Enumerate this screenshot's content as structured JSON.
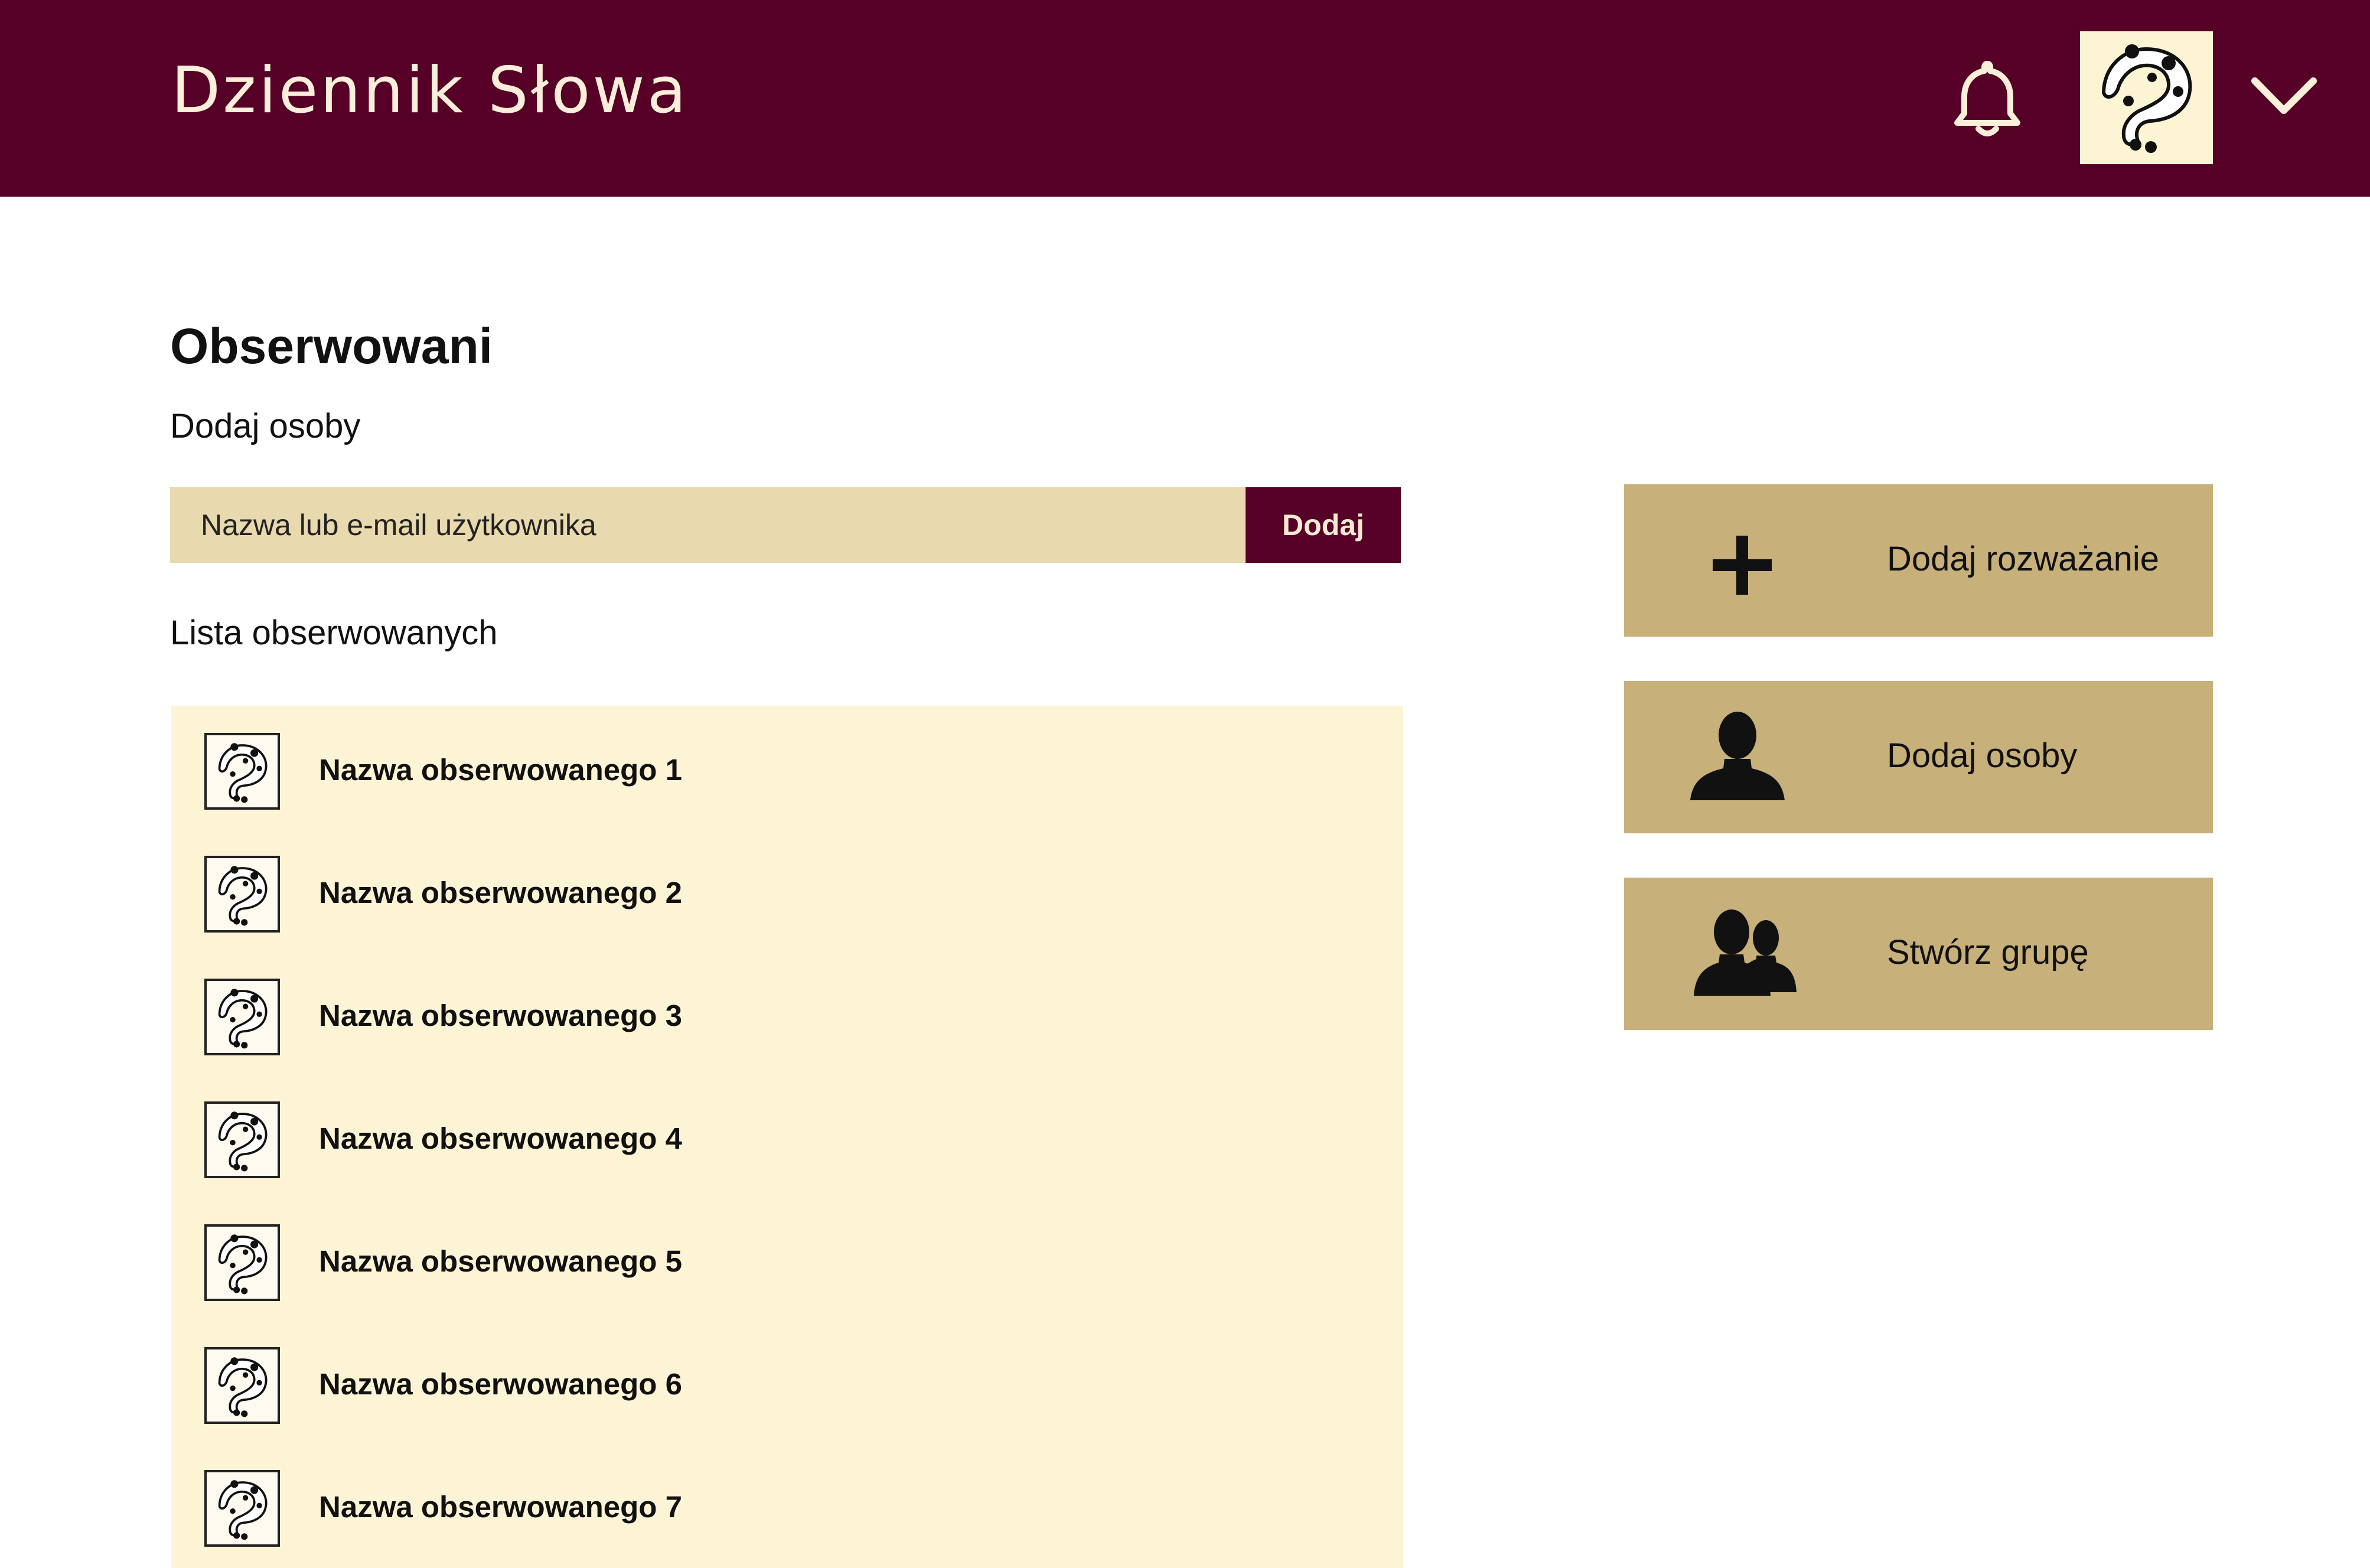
{
  "header": {
    "app_title": "Dziennik Słowa",
    "icons": [
      "bell-icon",
      "user-avatar",
      "chevron-down-icon"
    ],
    "background": "#560027"
  },
  "main": {
    "page_title": "Obserwowani",
    "add_people_label": "Dodaj osoby",
    "search": {
      "placeholder": "Nazwa lub e-mail użytkownika",
      "value": "",
      "button_label": "Dodaj"
    },
    "list_heading": "Lista obserwowanych",
    "followed": [
      {
        "name": "Nazwa obserwowanego 1"
      },
      {
        "name": "Nazwa obserwowanego 2"
      },
      {
        "name": "Nazwa obserwowanego 3"
      },
      {
        "name": "Nazwa obserwowanego 4"
      },
      {
        "name": "Nazwa obserwowanego 5"
      },
      {
        "name": "Nazwa obserwowanego 6"
      },
      {
        "name": "Nazwa obserwowanego 7"
      }
    ]
  },
  "actions": [
    {
      "label": "Dodaj rozważanie",
      "icon": "plus-icon"
    },
    {
      "label": "Dodaj osoby",
      "icon": "person-icon"
    },
    {
      "label": "Stwórz grupę",
      "icon": "group-icon"
    }
  ],
  "colors": {
    "accent": "#560027",
    "input_bg": "#e8d9ae",
    "list_bg": "#fdf4d6",
    "action_bg": "#c8b07b"
  }
}
